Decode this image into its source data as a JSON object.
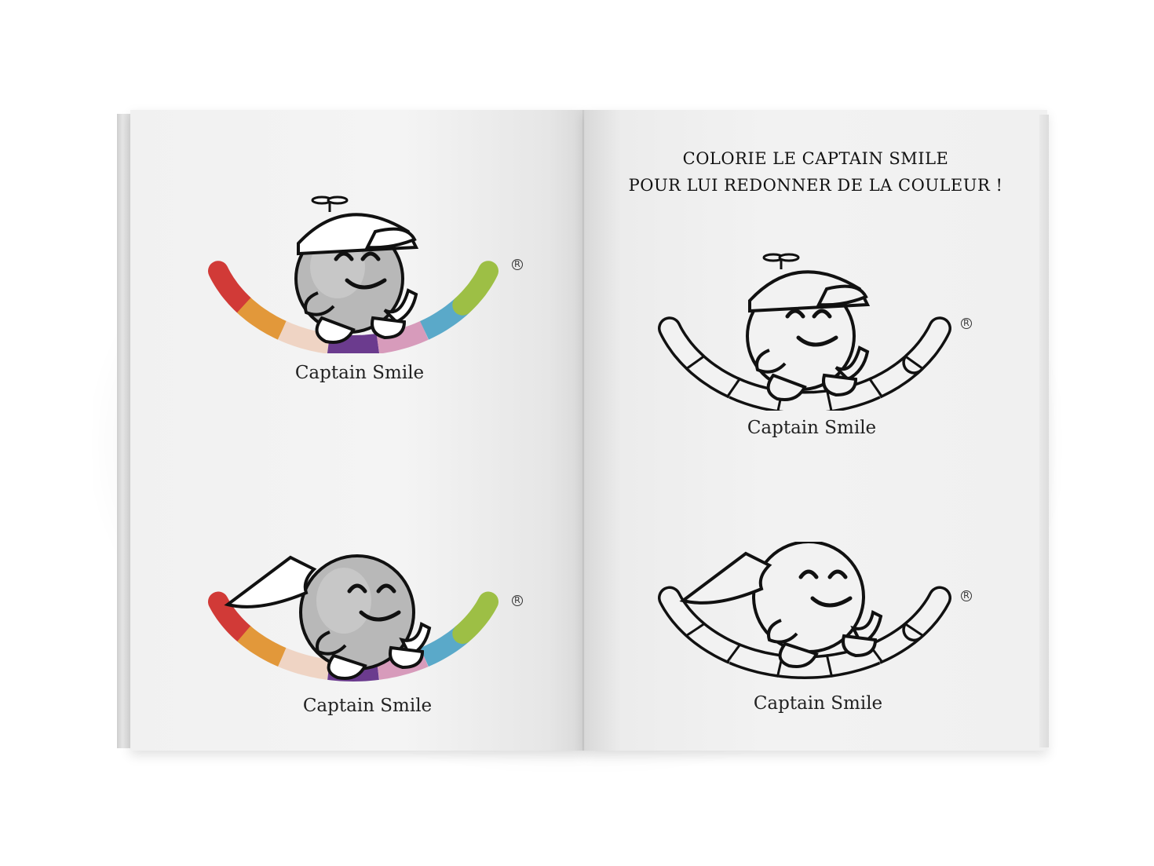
{
  "spread": {
    "right_page_heading_line1": "COLORIE LE CAPTAIN SMILE",
    "right_page_heading_line2": "POUR LUI REDONNER DE LA COULEUR !"
  },
  "logos": [
    {
      "caption": "Captain Smile",
      "registered": "R",
      "style": "color",
      "variant": "cap"
    },
    {
      "caption": "Captain Smile",
      "registered": "R",
      "style": "color",
      "variant": "cape"
    },
    {
      "caption": "Captain Smile",
      "registered": "R",
      "style": "outline",
      "variant": "cap"
    },
    {
      "caption": "Captain Smile",
      "registered": "R",
      "style": "outline",
      "variant": "cape"
    }
  ],
  "colors": {
    "rainbow": [
      "#d13a37",
      "#e2983a",
      "#efd4c4",
      "#6b3b8e",
      "#d79bbb",
      "#5aa9c9",
      "#9dbf45"
    ],
    "face": "#b8b8b8",
    "outline": "#111111"
  }
}
